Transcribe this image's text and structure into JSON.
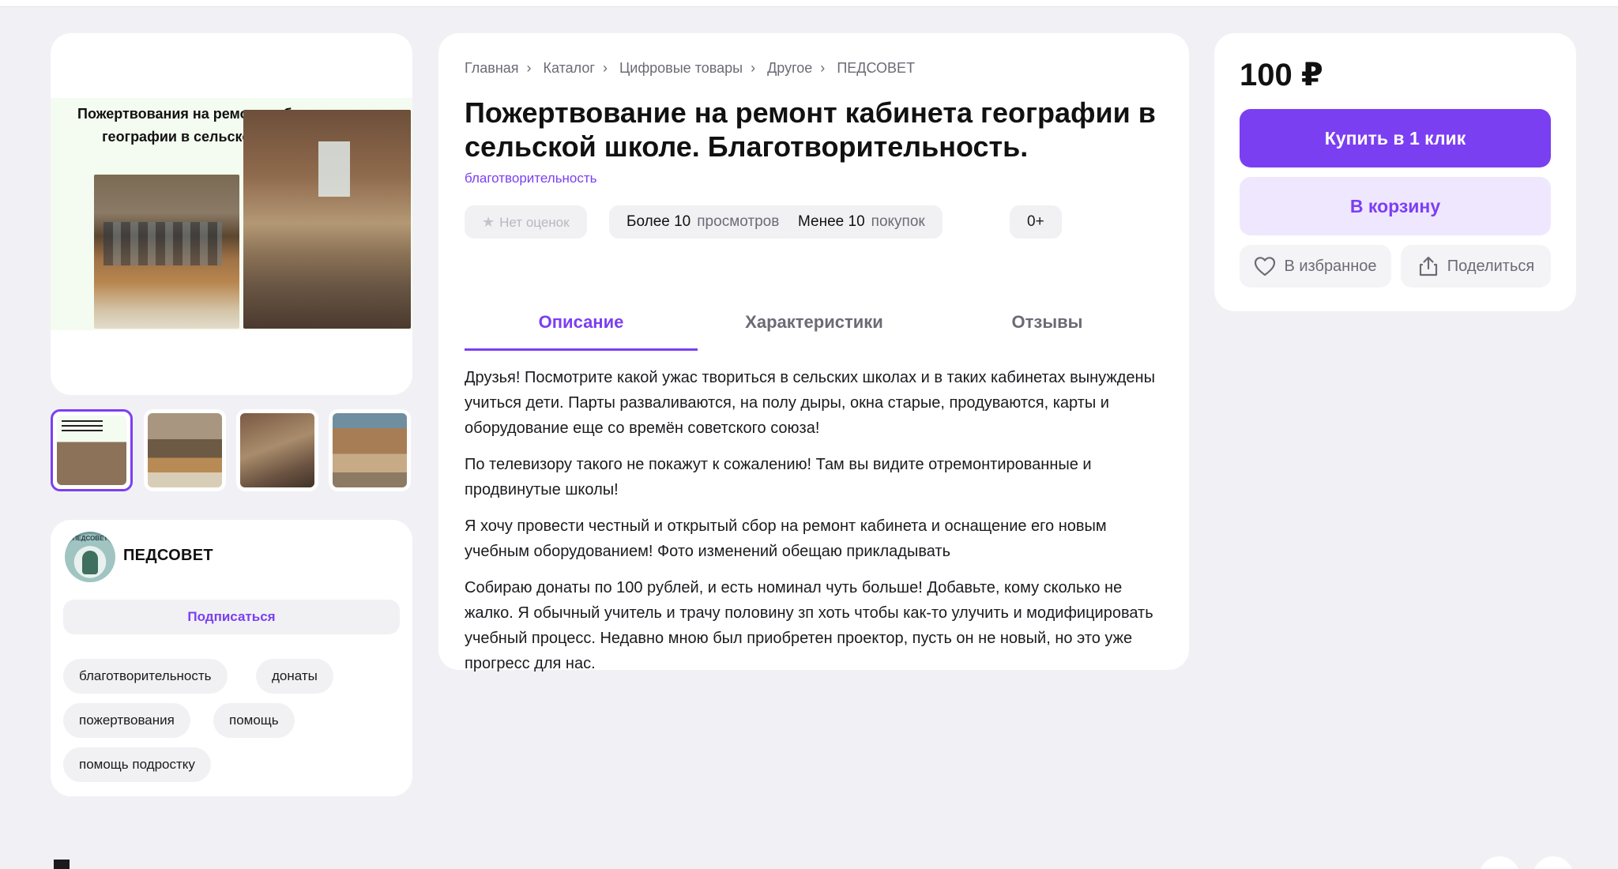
{
  "breadcrumbs": [
    "Главная",
    "Каталог",
    "Цифровые товары",
    "Другое",
    "ПЕДСОВЕТ"
  ],
  "product": {
    "title": "Пожертвование на ремонт кабинета географии в сельской школе. Благотворительность.",
    "category": "благотворительность",
    "image_caption": "Пожертвования на ремонт кабинета географии в сельской школе"
  },
  "chips": {
    "rating": "Нет оценок",
    "views_value": "Более 10",
    "views_label": "просмотров",
    "purchases_value": "Менее 10",
    "purchases_label": "покупок",
    "age": "0+"
  },
  "tabs": [
    "Описание",
    "Характеристики",
    "Отзывы"
  ],
  "description": [
    "Друзья! Посмотрите какой ужас твориться в сельских школах и в таких кабинетах вынуждены учиться дети. Парты разваливаются, на полу дыры, окна старые, продуваются, карты и оборудование еще со времён советского союза!",
    "По телевизору такого не покажут к сожалению! Там вы видите отремонтированные и продвинутые школы!",
    "Я хочу провести честный и открытый сбор на ремонт кабинета и оснащение его новым учебным оборудованием! Фото изменений обещаю прикладывать",
    "Собираю донаты по 100 рублей, и есть номинал чуть больше! Добавьте, кому сколько не жалко. Я обычный учитель и трачу половину зп хоть чтобы как-то улучить и модифицировать учебный процесс. Недавно мною был приобретен проектор, пусть он не новый, но это уже прогресс для нас."
  ],
  "seller": {
    "name": "ПЕДСОВЕТ",
    "avatar_text": "ПЕДСОВЕТ",
    "subscribe_label": "Подписаться",
    "tags": [
      "благотворительность",
      "донаты",
      "пожертвования",
      "помощь",
      "помощь подростку"
    ]
  },
  "purchase": {
    "price": "100 ₽",
    "buy_label": "Купить в 1 клик",
    "cart_label": "В корзину",
    "favorite_label": "В избранное",
    "share_label": "Поделиться"
  },
  "colors": {
    "accent": "#7b3ff2",
    "accent_light": "#efe7fe",
    "background": "#f1f1f5"
  },
  "icons": [
    "star-icon",
    "heart-icon",
    "share-icon"
  ]
}
